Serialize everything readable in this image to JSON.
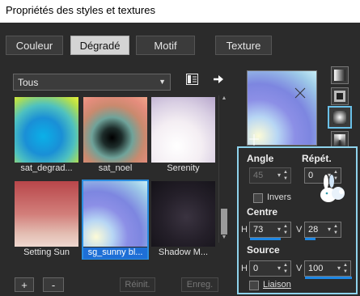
{
  "window": {
    "title": "Propriétés des styles et textures"
  },
  "tabs": [
    {
      "label": "Couleur",
      "active": false
    },
    {
      "label": "Dégradé",
      "active": true
    },
    {
      "label": "Motif",
      "active": false
    },
    {
      "label": "Texture",
      "active": false
    }
  ],
  "category": {
    "selected": "Tous"
  },
  "gallery": {
    "items": [
      {
        "label": "sat_degrad...",
        "selected": false
      },
      {
        "label": "sat_noel",
        "selected": false
      },
      {
        "label": "Serenity",
        "selected": false
      },
      {
        "label": "Setting Sun",
        "selected": false
      },
      {
        "label": "sg_sunny bl...",
        "selected": true
      },
      {
        "label": "Shadow M...",
        "selected": false
      }
    ]
  },
  "buttons": {
    "add": "+",
    "remove": "-",
    "reset": "Réinit.",
    "save": "Enreg."
  },
  "style_types": [
    "linear",
    "rectangular",
    "sunburst",
    "radial"
  ],
  "settings": {
    "angle_label": "Angle",
    "angle_value": "45",
    "repeat_label": "Répét.",
    "repeat_value": "0",
    "invert_label": "Invers",
    "centre_label": "Centre",
    "centre_h_label": "H",
    "centre_h_value": "73",
    "centre_v_label": "V",
    "centre_v_value": "28",
    "source_label": "Source",
    "source_h_label": "H",
    "source_h_value": "0",
    "source_v_label": "V",
    "source_v_value": "100",
    "link_label": "Liaison"
  },
  "accent_color": "#1e6fd6",
  "panel_border_color": "#8ed3ec"
}
